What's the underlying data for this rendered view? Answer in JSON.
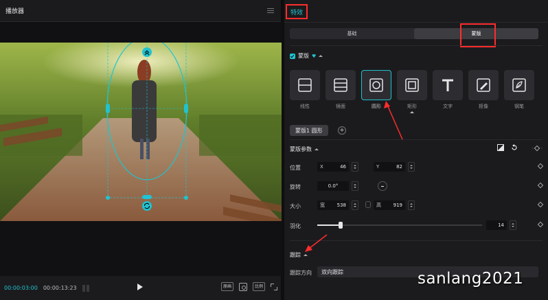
{
  "player": {
    "title": "播放器",
    "time_current": "00:00:03:00",
    "time_total": "00:00:13:23",
    "btn_fit": "原画",
    "btn_ratio": "比例"
  },
  "effects": {
    "tab_title": "特效",
    "segment": {
      "basic": "基础",
      "mask": "蒙版"
    },
    "mask_header": "蒙版",
    "shapes": [
      {
        "label": "线性",
        "icon": "linear-mask-icon"
      },
      {
        "label": "镜面",
        "icon": "mirror-mask-icon"
      },
      {
        "label": "圆形",
        "icon": "circle-mask-icon",
        "active": true
      },
      {
        "label": "矩形",
        "icon": "rectangle-mask-icon"
      },
      {
        "label": "文字",
        "icon": "text-mask-icon"
      },
      {
        "label": "抠像",
        "icon": "matting-mask-icon"
      },
      {
        "label": "钢笔",
        "icon": "pen-mask-icon"
      }
    ],
    "current_mask": "蒙版1 圆形",
    "params_title": "蒙版参数",
    "position": {
      "label": "位置",
      "x_prefix": "X",
      "x": "46",
      "y_prefix": "Y",
      "y": "82"
    },
    "rotation": {
      "label": "旋转",
      "value": "0.0°"
    },
    "size": {
      "label": "大小",
      "w_prefix": "宽",
      "w": "538",
      "h_prefix": "高",
      "h": "919"
    },
    "feather": {
      "label": "羽化",
      "value": "14",
      "fraction": 0.14
    },
    "tracking_title": "跟踪",
    "tracking_dir_label": "跟踪方向",
    "tracking_dir_value": "双向跟踪"
  },
  "watermark": "sanlang2021",
  "colors": {
    "accent": "#20c3d1",
    "highlight": "#ff2d2d"
  }
}
